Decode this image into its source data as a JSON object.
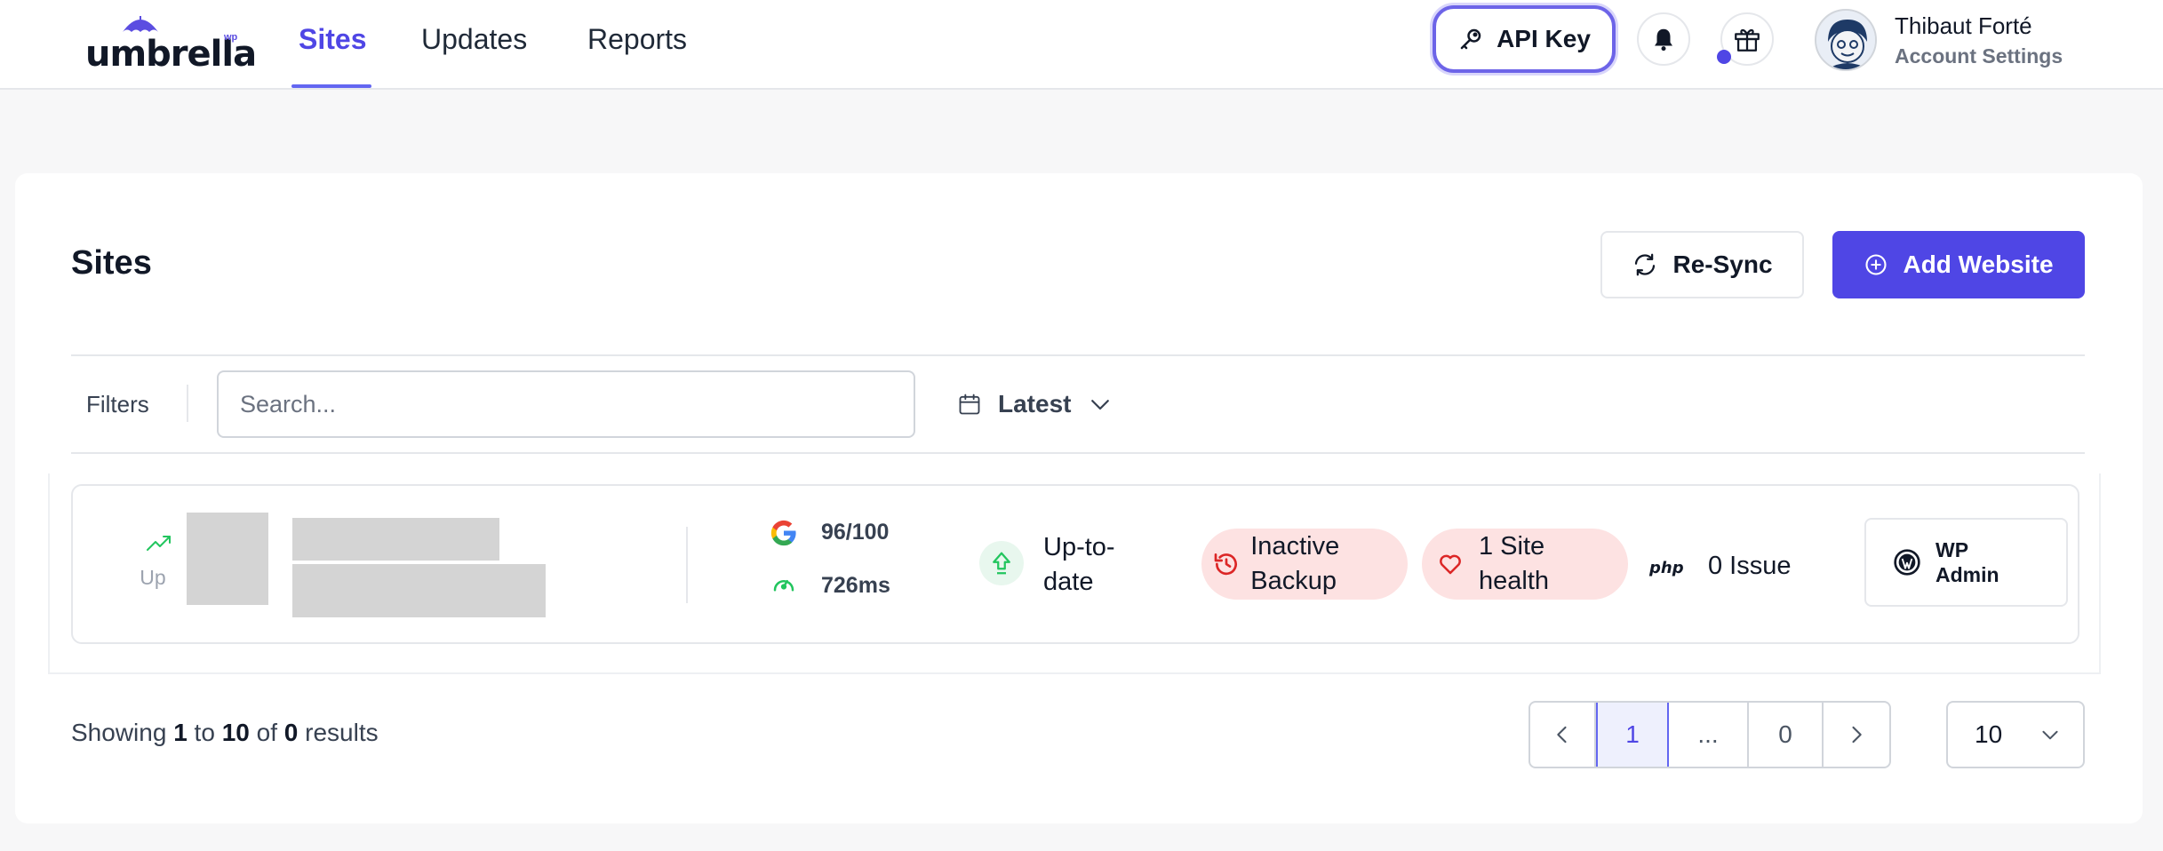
{
  "header": {
    "logo": {
      "text": "umbrella",
      "sup": "wp"
    },
    "nav": [
      {
        "label": "Sites",
        "active": true
      },
      {
        "label": "Updates",
        "active": false
      },
      {
        "label": "Reports",
        "active": false
      }
    ],
    "api_key_label": "API Key",
    "user": {
      "name": "Thibaut Forté",
      "subtitle": "Account Settings"
    }
  },
  "page": {
    "title": "Sites",
    "resync_label": "Re-Sync",
    "add_website_label": "Add Website"
  },
  "filters": {
    "label": "Filters",
    "search_placeholder": "Search...",
    "sort_label": "Latest"
  },
  "sites": [
    {
      "status": "Up",
      "google_score": "96/100",
      "response_time": "726ms",
      "updates_status": "Up-to-date",
      "backup_status": "Inactive Backup",
      "site_health": "1 Site health",
      "php_label": "php",
      "php_issues": "0 Issue",
      "wp_admin_label": "WP Admin"
    }
  ],
  "pagination": {
    "showing_prefix": "Showing",
    "from": "1",
    "to_word": "to",
    "to": "10",
    "of_word": "of",
    "total": "0",
    "results_word": "results",
    "pages": [
      "1",
      "...",
      "0"
    ],
    "per_page": "10"
  },
  "colors": {
    "accent": "#4f46e5",
    "pill_bg": "#fde2e2",
    "success": "#22c55e",
    "danger": "#dc2626"
  }
}
